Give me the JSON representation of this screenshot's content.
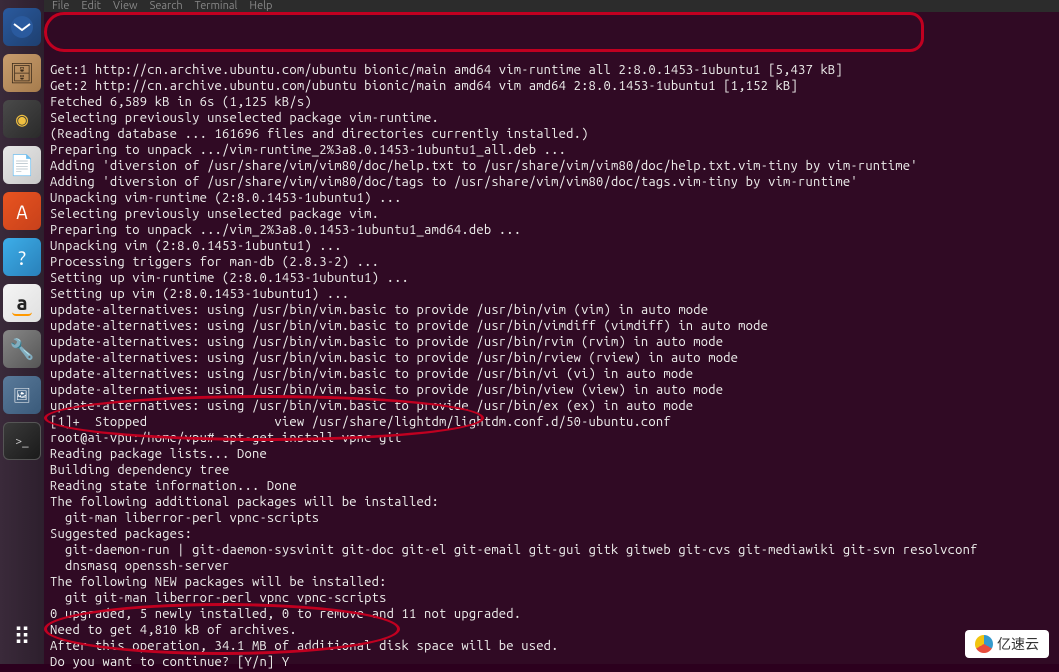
{
  "menubar": {
    "file": "File",
    "edit": "Edit",
    "view": "View",
    "search": "Search",
    "terminal": "Terminal",
    "help": "Help"
  },
  "launcher": {
    "thunderbird": "✉",
    "files": "🗄",
    "music": "◉",
    "writer": "📄",
    "software": "A",
    "help": "?",
    "amazon": "a",
    "settings": "🔧",
    "image": "🖼",
    "terminal": ">_",
    "apps": "⠿"
  },
  "terminal": {
    "lines": [
      "Get:1 http://cn.archive.ubuntu.com/ubuntu bionic/main amd64 vim-runtime all 2:8.0.1453-1ubuntu1 [5,437 kB]",
      "Get:2 http://cn.archive.ubuntu.com/ubuntu bionic/main amd64 vim amd64 2:8.0.1453-1ubuntu1 [1,152 kB]",
      "Fetched 6,589 kB in 6s (1,125 kB/s)",
      "Selecting previously unselected package vim-runtime.",
      "(Reading database ... 161696 files and directories currently installed.)",
      "Preparing to unpack .../vim-runtime_2%3a8.0.1453-1ubuntu1_all.deb ...",
      "Adding 'diversion of /usr/share/vim/vim80/doc/help.txt to /usr/share/vim/vim80/doc/help.txt.vim-tiny by vim-runtime'",
      "Adding 'diversion of /usr/share/vim/vim80/doc/tags to /usr/share/vim/vim80/doc/tags.vim-tiny by vim-runtime'",
      "Unpacking vim-runtime (2:8.0.1453-1ubuntu1) ...",
      "Selecting previously unselected package vim.",
      "Preparing to unpack .../vim_2%3a8.0.1453-1ubuntu1_amd64.deb ...",
      "Unpacking vim (2:8.0.1453-1ubuntu1) ...",
      "Processing triggers for man-db (2.8.3-2) ...",
      "Setting up vim-runtime (2:8.0.1453-1ubuntu1) ...",
      "Setting up vim (2:8.0.1453-1ubuntu1) ...",
      "update-alternatives: using /usr/bin/vim.basic to provide /usr/bin/vim (vim) in auto mode",
      "update-alternatives: using /usr/bin/vim.basic to provide /usr/bin/vimdiff (vimdiff) in auto mode",
      "update-alternatives: using /usr/bin/vim.basic to provide /usr/bin/rvim (rvim) in auto mode",
      "update-alternatives: using /usr/bin/vim.basic to provide /usr/bin/rview (rview) in auto mode",
      "update-alternatives: using /usr/bin/vim.basic to provide /usr/bin/vi (vi) in auto mode",
      "update-alternatives: using /usr/bin/vim.basic to provide /usr/bin/view (view) in auto mode",
      "update-alternatives: using /usr/bin/vim.basic to provide /usr/bin/ex (ex) in auto mode",
      "",
      "[1]+  Stopped                 view /usr/share/lightdm/lightdm.conf.d/50-ubuntu.conf",
      "root@ai-vpu:/home/vpu# apt-get install vpnc git",
      "Reading package lists... Done",
      "Building dependency tree",
      "Reading state information... Done",
      "The following additional packages will be installed:",
      "  git-man liberror-perl vpnc-scripts",
      "Suggested packages:",
      "  git-daemon-run | git-daemon-sysvinit git-doc git-el git-email git-gui gitk gitweb git-cvs git-mediawiki git-svn resolvconf",
      "  dnsmasq openssh-server",
      "The following NEW packages will be installed:",
      "  git git-man liberror-perl vpnc vpnc-scripts",
      "0 upgraded, 5 newly installed, 0 to remove and 11 not upgraded.",
      "Need to get 4,810 kB of archives.",
      "After this operation, 34.1 MB of additional disk space will be used.",
      "Do you want to continue? [Y/n] Y"
    ]
  },
  "watermark": {
    "text": "亿速云"
  }
}
